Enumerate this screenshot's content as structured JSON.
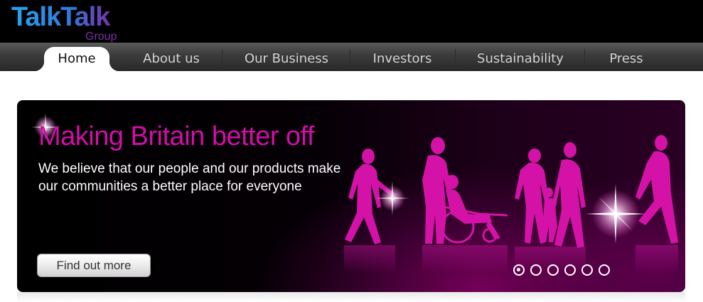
{
  "brand": {
    "logo_text": "TalkTalk",
    "logo_sub": "Group",
    "accent": "#d10fa8",
    "logo_blue": "#1e88e5",
    "logo_purple": "#7b2fa8"
  },
  "nav": {
    "items": [
      {
        "label": "Home",
        "active": true
      },
      {
        "label": "About us",
        "active": false
      },
      {
        "label": "Our Business",
        "active": false
      },
      {
        "label": "Investors",
        "active": false
      },
      {
        "label": "Sustainability",
        "active": false
      },
      {
        "label": "Press",
        "active": false
      }
    ]
  },
  "hero": {
    "title": "Making Britain better off",
    "text": "We believe that our people and our products make our communities a better place for everyone",
    "button_label": "Find out more",
    "slides": 6,
    "active_slide": 1,
    "image_subject": "silhouettes-of-people-walking-icon"
  }
}
